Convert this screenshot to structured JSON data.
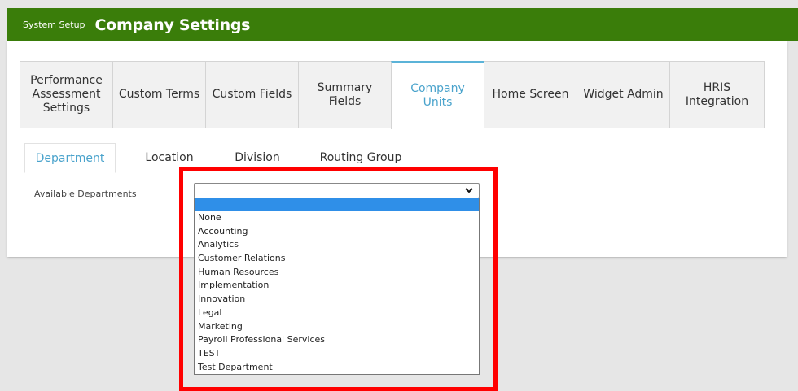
{
  "header": {
    "crumb": "System Setup",
    "title": "Company Settings",
    "bg_color": "#3a7d0a"
  },
  "tabs": [
    {
      "label": "Performance Assessment Settings"
    },
    {
      "label": "Custom Terms"
    },
    {
      "label": "Custom Fields"
    },
    {
      "label": "Summary Fields"
    },
    {
      "label": "Company Units",
      "active": true
    },
    {
      "label": "Home Screen"
    },
    {
      "label": "Widget Admin"
    },
    {
      "label": "HRIS Integration"
    }
  ],
  "subtabs": [
    {
      "label": "Department",
      "active": true
    },
    {
      "label": "Location"
    },
    {
      "label": "Division"
    },
    {
      "label": "Routing Group"
    }
  ],
  "department_field": {
    "label": "Available Departments",
    "selected_value": "",
    "options": [
      "None",
      "Accounting",
      "Analytics",
      "Customer Relations",
      "Human Resources",
      "Implementation",
      "Innovation",
      "Legal",
      "Marketing",
      "Payroll Professional Services",
      "TEST",
      "Test Department"
    ]
  },
  "colors": {
    "accent": "#4aa3cc",
    "highlight": "#2f8fe8",
    "annotation": "#ff0000"
  }
}
